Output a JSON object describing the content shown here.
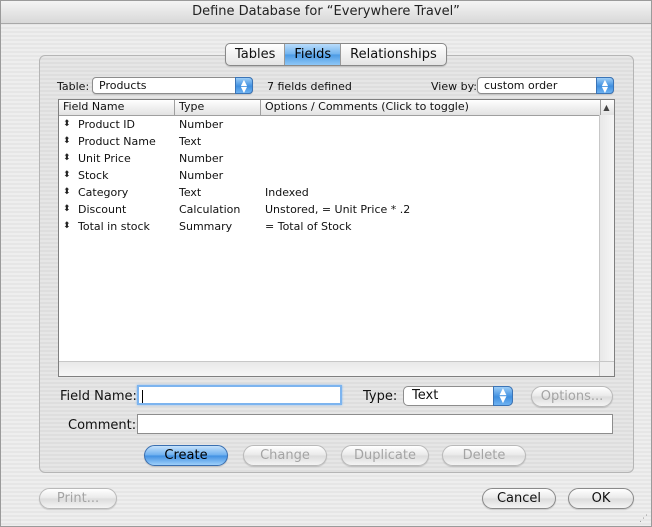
{
  "window": {
    "title": "Define Database for “Everywhere Travel”"
  },
  "tabs": [
    {
      "label": "Tables",
      "active": false
    },
    {
      "label": "Fields",
      "active": true
    },
    {
      "label": "Relationships",
      "active": false
    }
  ],
  "table_selector": {
    "label": "Table:",
    "value": "Products"
  },
  "fields_count_text": "7 fields defined",
  "view_by": {
    "label": "View by:",
    "value": "custom order"
  },
  "columns": [
    "Field Name",
    "Type",
    "Options / Comments   (Click to toggle)"
  ],
  "sort_icon": "sort-triangle-icon",
  "rows": [
    {
      "name": "Product ID",
      "type": "Number",
      "options": ""
    },
    {
      "name": "Product Name",
      "type": "Text",
      "options": ""
    },
    {
      "name": "Unit Price",
      "type": "Number",
      "options": ""
    },
    {
      "name": "Stock",
      "type": "Number",
      "options": ""
    },
    {
      "name": "Category",
      "type": "Text",
      "options": "Indexed"
    },
    {
      "name": "Discount",
      "type": "Calculation",
      "options": "Unstored, = Unit Price * .2"
    },
    {
      "name": "Total in stock",
      "type": "Summary",
      "options": "= Total of Stock"
    }
  ],
  "form": {
    "field_name_label": "Field Name:",
    "field_name_value": "",
    "type_label": "Type:",
    "type_value": "Text",
    "options_button": "Options...",
    "comment_label": "Comment:",
    "comment_value": ""
  },
  "actions": {
    "create": "Create",
    "change": "Change",
    "duplicate": "Duplicate",
    "delete": "Delete"
  },
  "footer": {
    "print": "Print...",
    "cancel": "Cancel",
    "ok": "OK"
  },
  "colors": {
    "accent": "#4b9ae4",
    "disabled_text": "#a4a4a4"
  }
}
